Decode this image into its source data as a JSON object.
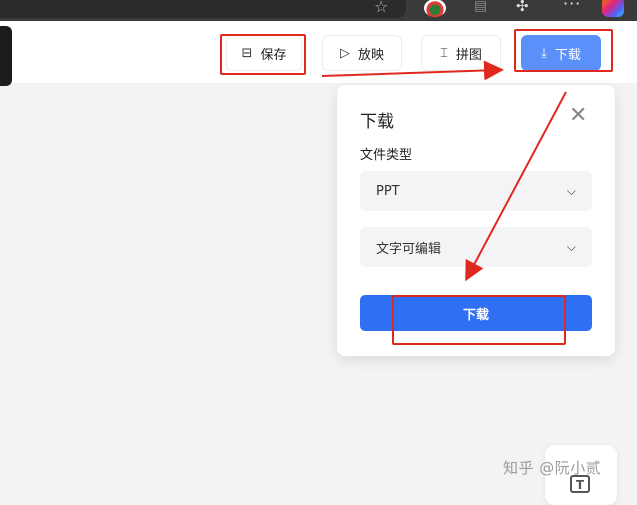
{
  "toolbar": {
    "save_label": "保存",
    "play_label": "放映",
    "merge_label": "拼图",
    "download_label": "下载"
  },
  "icons": {
    "save": "save-icon",
    "play": "play-icon",
    "merge": "merge-icon",
    "download": "download-icon",
    "close": "close-icon",
    "chevron": "chevron-down-icon",
    "text_tool": "text-tool-icon"
  },
  "download_panel": {
    "title": "下载",
    "file_type_label": "文件类型",
    "file_type_value": "PPT",
    "export_mode_value": "文字可编辑",
    "submit_label": "下载"
  },
  "text_tool_glyph": "T",
  "watermark": "知乎 @阮小贰",
  "colors": {
    "accent": "#2f6ff2",
    "download_button": "#5b8ff9",
    "annotation": "#e0281f"
  }
}
